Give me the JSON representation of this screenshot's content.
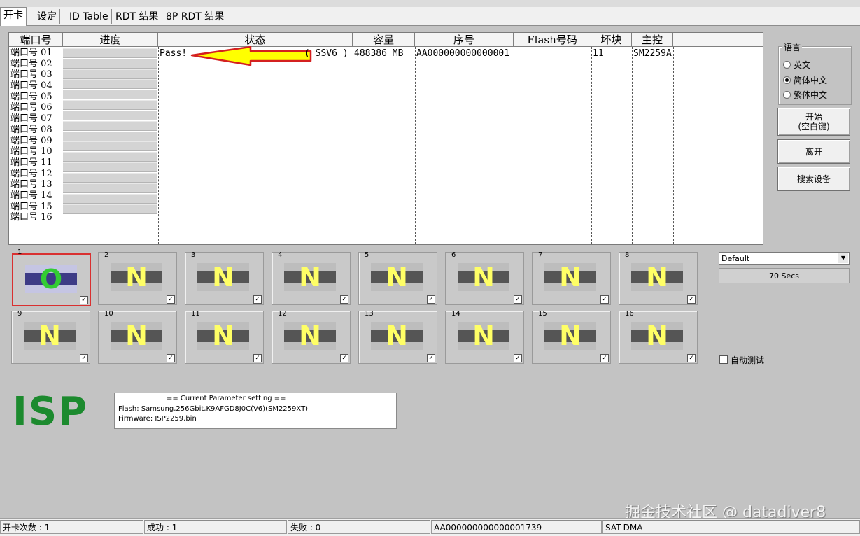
{
  "tabs": [
    "开卡",
    "设定",
    "ID Table",
    "RDT 结果",
    "8P RDT 结果"
  ],
  "grid": {
    "columns": [
      "端口号",
      "进度",
      "状态",
      "容量",
      "序号",
      "Flash号码",
      "坏块",
      "主控"
    ],
    "ports": [
      "端口号 01",
      "端口号 02",
      "端口号 03",
      "端口号 04",
      "端口号 05",
      "端口号 06",
      "端口号 07",
      "端口号 08",
      "端口号 09",
      "端口号 10",
      "端口号 11",
      "端口号 12",
      "端口号 13",
      "端口号 14",
      "端口号 15",
      "端口号 16"
    ],
    "row1": {
      "status": "Pass!",
      "status_tail": "( SSV6 )",
      "capacity": "488386 MB",
      "serial": "AA000000000000001",
      "flash": "",
      "badblock": "11",
      "controller": "SM2259A"
    }
  },
  "language": {
    "title": "语言",
    "options": [
      "英文",
      "简体中文",
      "繁体中文"
    ],
    "selected": "简体中文"
  },
  "buttons": {
    "start": "开始\n(空白键)",
    "leave": "离开",
    "search": "搜索设备"
  },
  "profile": {
    "selected": "Default",
    "timer": "70 Secs"
  },
  "slots": [
    {
      "num": "1",
      "state": "O"
    },
    {
      "num": "2",
      "state": "N"
    },
    {
      "num": "3",
      "state": "N"
    },
    {
      "num": "4",
      "state": "N"
    },
    {
      "num": "5",
      "state": "N"
    },
    {
      "num": "6",
      "state": "N"
    },
    {
      "num": "7",
      "state": "N"
    },
    {
      "num": "8",
      "state": "N"
    },
    {
      "num": "9",
      "state": "N"
    },
    {
      "num": "10",
      "state": "N"
    },
    {
      "num": "11",
      "state": "N"
    },
    {
      "num": "12",
      "state": "N"
    },
    {
      "num": "13",
      "state": "N"
    },
    {
      "num": "14",
      "state": "N"
    },
    {
      "num": "15",
      "state": "N"
    },
    {
      "num": "16",
      "state": "N"
    }
  ],
  "auto_test": {
    "label": "自动测试",
    "checked": false
  },
  "isp_label": "ISP",
  "params": {
    "header": "== Current Parameter setting ==",
    "flash": "Flash:   Samsung,256Gbit,K9AFGD8J0C(V6)(SM2259XT)",
    "firmware": "Firmware:   ISP2259.bin"
  },
  "watermark": "掘金技术社区 @ datadiver8",
  "statusbar": {
    "count": "开卡次数 : 1",
    "success": "成功 : 1",
    "fail": "失败 : 0",
    "serial": "AA000000000000001739",
    "mode": "SAT-DMA"
  },
  "colors": {
    "arrow": "#ffff00",
    "arrow_border": "#d42020",
    "isp": "#1c8a2e",
    "selected_slot": "#d93030"
  }
}
